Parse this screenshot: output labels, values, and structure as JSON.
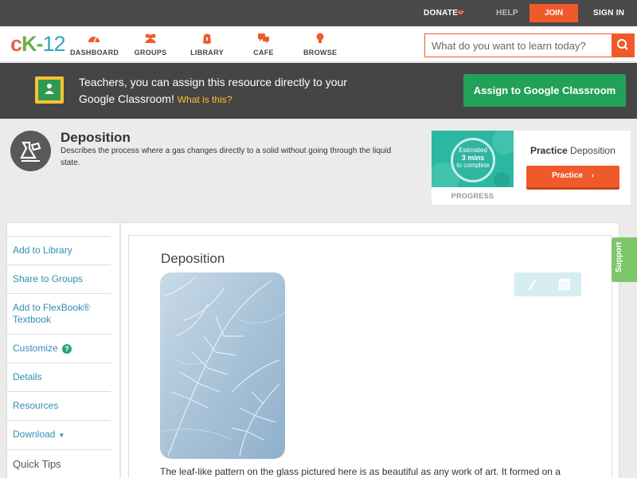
{
  "topbar": {
    "donate": "DONATE",
    "help": "HELP",
    "join": "JOIN",
    "signin": "SIGN IN"
  },
  "nav": {
    "logo": {
      "c": "c",
      "k": "K",
      "dash": "-",
      "num": "12"
    },
    "items": [
      {
        "label": "DASHBOARD",
        "icon": "dashboard-icon"
      },
      {
        "label": "GROUPS",
        "icon": "groups-icon"
      },
      {
        "label": "LIBRARY",
        "icon": "library-icon"
      },
      {
        "label": "CAFE",
        "icon": "cafe-icon"
      },
      {
        "label": "BROWSE",
        "icon": "browse-icon"
      }
    ],
    "search_placeholder": "What do you want to learn today?"
  },
  "banner": {
    "text": "Teachers, you can assign this resource directly to your Google Classroom!",
    "what": "What is this?",
    "button": "Assign to Google Classroom"
  },
  "concept": {
    "title": "Deposition",
    "description": "Describes the process where a gas changes directly to a solid without going through the liquid state."
  },
  "practice": {
    "estimated": "Estimated",
    "mins": "3 mins",
    "to_complete": "to complete",
    "progress": "PROGRESS",
    "title_bold": "Practice",
    "title_rest": " Deposition",
    "button": "Practice"
  },
  "sidebar": {
    "items": [
      "Add to Library",
      "Share to Groups",
      "Add to FlexBook®",
      "Textbook",
      "Customize",
      "Details",
      "Resources",
      "Download",
      "Quick Tips"
    ]
  },
  "article": {
    "title": "Deposition",
    "body": "The leaf-like pattern on the glass pictured here is as beautiful as any work of art. It formed on a"
  },
  "support": "Support",
  "colors": {
    "accent": "#f05a2a",
    "green": "#24a159",
    "link": "#2f8fb0"
  }
}
